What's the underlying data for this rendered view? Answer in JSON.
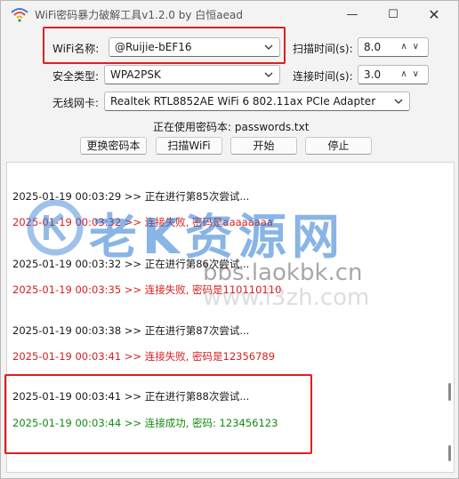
{
  "window": {
    "title": "WiFi密码暴力破解工具v1.2.0 by 白恒aead",
    "minimize_glyph": "—",
    "maximize_glyph": "☐",
    "close_glyph": "✕"
  },
  "form": {
    "wifi_label": "WiFi名称:",
    "wifi_value": "@Ruijie-bEF16",
    "scan_time_label": "扫描时间(s):",
    "scan_time_value": "8.0",
    "security_label": "安全类型:",
    "security_value": "WPA2PSK",
    "connect_time_label": "连接时间(s):",
    "connect_time_value": "3.0",
    "adapter_label": "无线网卡:",
    "adapter_value": "Realtek RTL8852AE WiFi 6 802.11ax PCIe Adapter",
    "using_password_text": "正在使用密码本: passwords.txt",
    "spin_arrows": "∧∨"
  },
  "buttons": {
    "change_book": "更换密码本",
    "scan_wifi": "扫描WiFi",
    "start": "开始",
    "stop": "停止"
  },
  "log": [
    {
      "text": "2025-01-19 00:03:29 >> 正在进行第85次尝试...",
      "color": "#1a1a1a"
    },
    {
      "text": "2025-01-19 00:03:32 >> 连接失败, 密码是aaaaaaaa",
      "color": "#d81e1e"
    },
    {
      "text": "2025-01-19 00:03:32 >> 正在进行第86次尝试...",
      "color": "#1a1a1a"
    },
    {
      "text": "2025-01-19 00:03:35 >> 连接失败, 密码是110110110",
      "color": "#d81e1e"
    },
    {
      "text": "2025-01-19 00:03:38 >> 正在进行第87次尝试...",
      "color": "#1a1a1a"
    },
    {
      "text": "2025-01-19 00:03:41 >> 连接失败, 密码是12356789",
      "color": "#d81e1e"
    },
    {
      "text": "2025-01-19 00:03:41 >> 正在进行第88次尝试...",
      "color": "#1a1a1a"
    },
    {
      "text": "2025-01-19 00:03:44 >> 连接成功, 密码: 123456123",
      "color": "#138a13"
    }
  ],
  "watermark": {
    "logo_text": "老K资源网",
    "url_primary": "bbs.laokbk.cn",
    "url_secondary": "www.i3zh.com"
  }
}
